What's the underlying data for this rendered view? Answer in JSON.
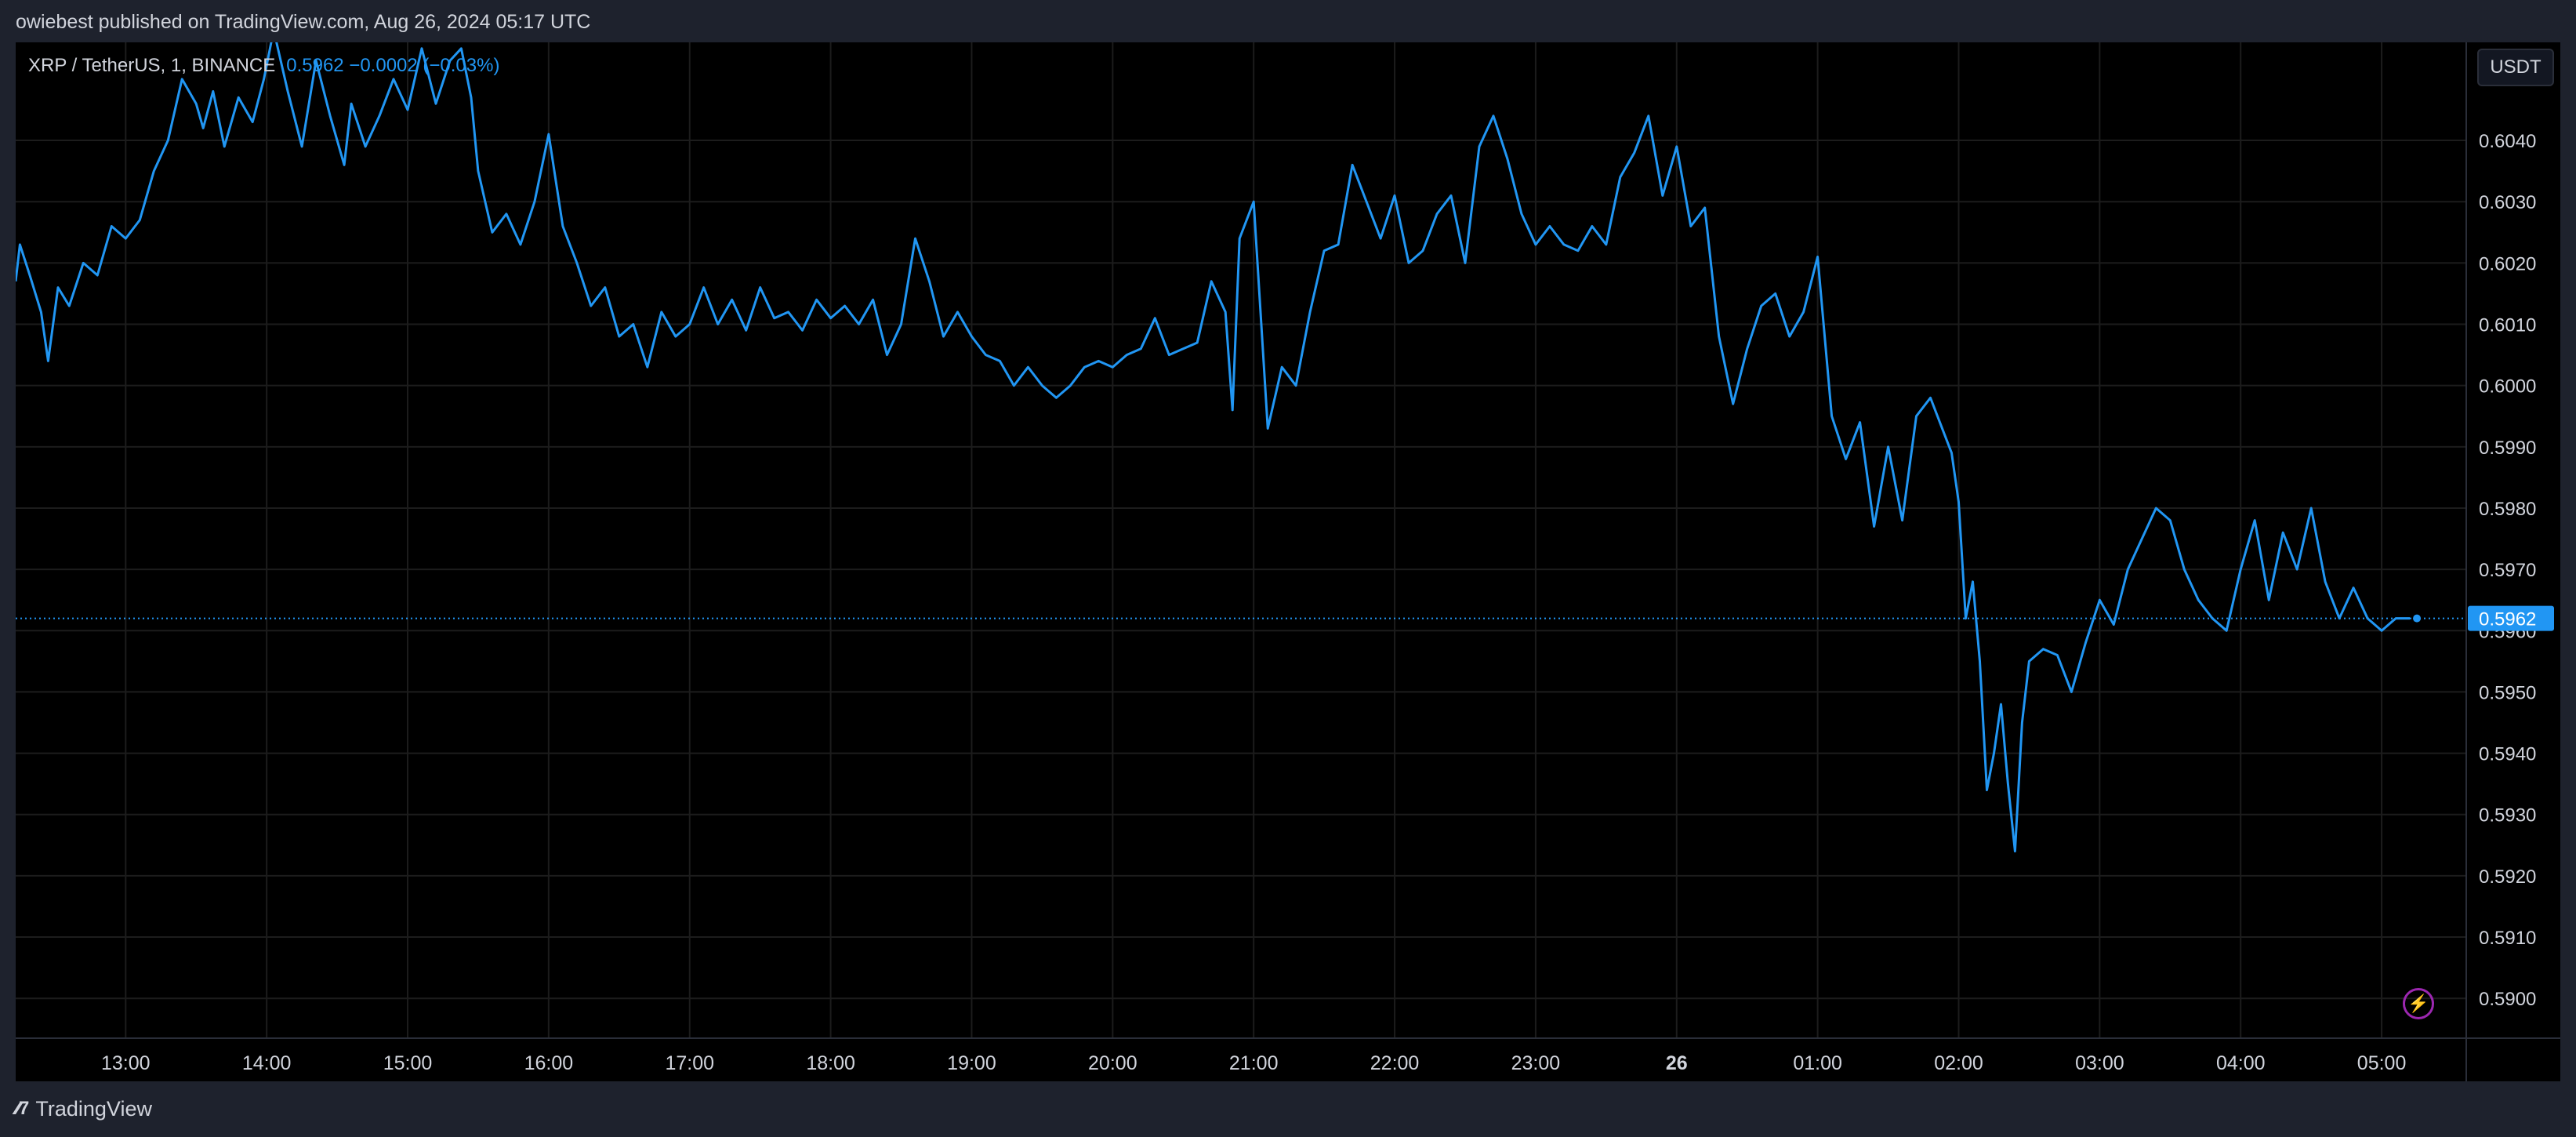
{
  "header": {
    "published_by": "owiebest published on TradingView.com, Aug 26, 2024 05:17 UTC"
  },
  "legend": {
    "symbol": "XRP / TetherUS, 1, BINANCE",
    "values": "0.5962  −0.0002 (−0.03%)"
  },
  "unit_button": "USDT",
  "footer": {
    "brand": "TradingView",
    "logo_icon": "tradingview-logo-icon"
  },
  "bolt_icon": "lightning-bolt-icon",
  "colors": {
    "background": "#000000",
    "line": "#2196f3",
    "grid": "#1c1c1c",
    "text": "#d1d4dc",
    "price_label_bg": "#2196f3"
  },
  "chart_data": {
    "type": "line",
    "title": "XRP / TetherUS, 1, BINANCE",
    "xlabel": "",
    "ylabel": "",
    "ylim": [
      0.58935,
      0.6056
    ],
    "xlim_hours": [
      12.22,
      29.6
    ],
    "last_value": 0.5962,
    "last_value_label": "0.5962",
    "grid": true,
    "legend_position": "top-left",
    "y_ticks": [
      0.604,
      0.603,
      0.602,
      0.601,
      0.6,
      0.599,
      0.598,
      0.597,
      0.596,
      0.595,
      0.594,
      0.593,
      0.592,
      0.591,
      0.59
    ],
    "y_tick_labels": [
      "0.6040",
      "0.6030",
      "0.6020",
      "0.6010",
      "0.6000",
      "0.5990",
      "0.5980",
      "0.5970",
      "0.5960",
      "0.5950",
      "0.5940",
      "0.5930",
      "0.5920",
      "0.5910",
      "0.5900"
    ],
    "x_ticks": [
      {
        "label": "13:00",
        "h": 13,
        "bold": false
      },
      {
        "label": "14:00",
        "h": 14,
        "bold": false
      },
      {
        "label": "15:00",
        "h": 15,
        "bold": false
      },
      {
        "label": "16:00",
        "h": 16,
        "bold": false
      },
      {
        "label": "17:00",
        "h": 17,
        "bold": false
      },
      {
        "label": "18:00",
        "h": 18,
        "bold": false
      },
      {
        "label": "19:00",
        "h": 19,
        "bold": false
      },
      {
        "label": "20:00",
        "h": 20,
        "bold": false
      },
      {
        "label": "21:00",
        "h": 21,
        "bold": false
      },
      {
        "label": "22:00",
        "h": 22,
        "bold": false
      },
      {
        "label": "23:00",
        "h": 23,
        "bold": false
      },
      {
        "label": "26",
        "h": 24,
        "bold": true
      },
      {
        "label": "01:00",
        "h": 25,
        "bold": false
      },
      {
        "label": "02:00",
        "h": 26,
        "bold": false
      },
      {
        "label": "03:00",
        "h": 27,
        "bold": false
      },
      {
        "label": "04:00",
        "h": 28,
        "bold": false
      },
      {
        "label": "05:00",
        "h": 29,
        "bold": false
      }
    ],
    "series": [
      {
        "x_hours": [
          12.22,
          12.25,
          12.32,
          12.4,
          12.45,
          12.52,
          12.6,
          12.7,
          12.8,
          12.9,
          13.0,
          13.1,
          13.2,
          13.3,
          13.4,
          13.5,
          13.55,
          13.62,
          13.7,
          13.8,
          13.9,
          13.98,
          14.05,
          14.15,
          14.25,
          14.35,
          14.45,
          14.55,
          14.6,
          14.7,
          14.8,
          14.9,
          15.0,
          15.1,
          15.2,
          15.3,
          15.38,
          15.45,
          15.5,
          15.6,
          15.7,
          15.8,
          15.9,
          16.0,
          16.1,
          16.2,
          16.3,
          16.4,
          16.5,
          16.6,
          16.7,
          16.8,
          16.9,
          17.0,
          17.1,
          17.2,
          17.3,
          17.4,
          17.5,
          17.6,
          17.7,
          17.8,
          17.9,
          18.0,
          18.1,
          18.2,
          18.3,
          18.4,
          18.5,
          18.6,
          18.7,
          18.8,
          18.9,
          19.0,
          19.1,
          19.2,
          19.3,
          19.4,
          19.5,
          19.6,
          19.7,
          19.8,
          19.9,
          20.0,
          20.1,
          20.2,
          20.3,
          20.4,
          20.5,
          20.6,
          20.7,
          20.8,
          20.85,
          20.9,
          21.0,
          21.1,
          21.2,
          21.3,
          21.4,
          21.5,
          21.6,
          21.7,
          21.8,
          21.9,
          22.0,
          22.1,
          22.2,
          22.3,
          22.4,
          22.5,
          22.6,
          22.7,
          22.8,
          22.9,
          23.0,
          23.1,
          23.2,
          23.3,
          23.4,
          23.5,
          23.6,
          23.7,
          23.8,
          23.9,
          24.0,
          24.1,
          24.2,
          24.3,
          24.4,
          24.5,
          24.6,
          24.7,
          24.8,
          24.9,
          25.0,
          25.1,
          25.2,
          25.3,
          25.4,
          25.5,
          25.6,
          25.7,
          25.8,
          25.9,
          25.95,
          26.0,
          26.05,
          26.1,
          26.15,
          26.2,
          26.25,
          26.3,
          26.35,
          26.4,
          26.45,
          26.5,
          26.6,
          26.7,
          26.8,
          26.9,
          27.0,
          27.1,
          27.2,
          27.3,
          27.4,
          27.5,
          27.6,
          27.7,
          27.8,
          27.9,
          28.0,
          28.1,
          28.2,
          28.3,
          28.4,
          28.5,
          28.6,
          28.7,
          28.8,
          28.9,
          29.0,
          29.1,
          29.2,
          29.25
        ],
        "values": [
          0.6017,
          0.6023,
          0.6018,
          0.6012,
          0.6004,
          0.6016,
          0.6013,
          0.602,
          0.6018,
          0.6026,
          0.6024,
          0.6027,
          0.6035,
          0.604,
          0.605,
          0.6046,
          0.6042,
          0.6048,
          0.6039,
          0.6047,
          0.6043,
          0.605,
          0.6058,
          0.6048,
          0.6039,
          0.6053,
          0.6044,
          0.6036,
          0.6046,
          0.6039,
          0.6044,
          0.605,
          0.6045,
          0.6055,
          0.6046,
          0.6053,
          0.6055,
          0.6047,
          0.6035,
          0.6025,
          0.6028,
          0.6023,
          0.603,
          0.6041,
          0.6026,
          0.602,
          0.6013,
          0.6016,
          0.6008,
          0.601,
          0.6003,
          0.6012,
          0.6008,
          0.601,
          0.6016,
          0.601,
          0.6014,
          0.6009,
          0.6016,
          0.6011,
          0.6012,
          0.6009,
          0.6014,
          0.6011,
          0.6013,
          0.601,
          0.6014,
          0.6005,
          0.601,
          0.6024,
          0.6017,
          0.6008,
          0.6012,
          0.6008,
          0.6005,
          0.6004,
          0.6,
          0.6003,
          0.6,
          0.5998,
          0.6,
          0.6003,
          0.6004,
          0.6003,
          0.6005,
          0.6006,
          0.6011,
          0.6005,
          0.6006,
          0.6007,
          0.6017,
          0.6012,
          0.5996,
          0.6024,
          0.603,
          0.5993,
          0.6003,
          0.6,
          0.6012,
          0.6022,
          0.6023,
          0.6036,
          0.603,
          0.6024,
          0.6031,
          0.602,
          0.6022,
          0.6028,
          0.6031,
          0.602,
          0.6039,
          0.6044,
          0.6037,
          0.6028,
          0.6023,
          0.6026,
          0.6023,
          0.6022,
          0.6026,
          0.6023,
          0.6034,
          0.6038,
          0.6044,
          0.6031,
          0.6039,
          0.6026,
          0.6029,
          0.6008,
          0.5997,
          0.6006,
          0.6013,
          0.6015,
          0.6008,
          0.6012,
          0.6021,
          0.5995,
          0.5988,
          0.5994,
          0.5977,
          0.599,
          0.5978,
          0.5995,
          0.5998,
          0.5992,
          0.5989,
          0.5981,
          0.5962,
          0.5968,
          0.5955,
          0.5934,
          0.594,
          0.5948,
          0.5935,
          0.5924,
          0.5945,
          0.5955,
          0.5957,
          0.5956,
          0.595,
          0.5958,
          0.5965,
          0.5961,
          0.597,
          0.5975,
          0.598,
          0.5978,
          0.597,
          0.5965,
          0.5962,
          0.596,
          0.597,
          0.5978,
          0.5965,
          0.5976,
          0.597,
          0.598,
          0.5968,
          0.5962,
          0.5967,
          0.5962,
          0.596,
          0.5962,
          0.5962
        ]
      }
    ]
  }
}
